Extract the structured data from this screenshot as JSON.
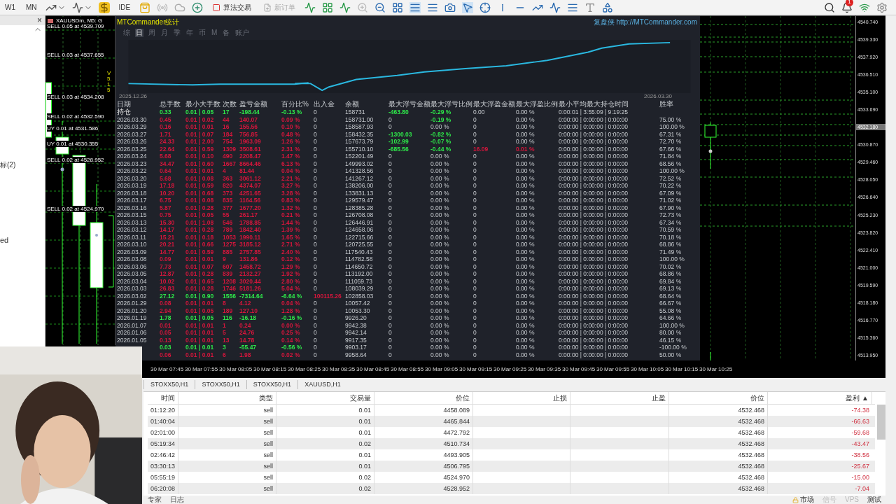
{
  "toolbar": {
    "periods": [
      "W1",
      "MN"
    ],
    "ide": "IDE",
    "algo_trading": {
      "label": "算法交易",
      "on": false
    },
    "new_order": {
      "label": "新订单",
      "disabled": true
    },
    "notifications": "1"
  },
  "navigator": {
    "close": "×",
    "items": [
      "标(2)",
      "ed"
    ]
  },
  "chart": {
    "title": "XAUUSDm, M5: G",
    "version": "V5.15",
    "orders": [
      {
        "text": "SELL 0.05 at 4539.709"
      },
      {
        "text": "SELL 0.03 at 4537.655"
      },
      {
        "text": "SELL 0.03 at 4534.208"
      },
      {
        "text": "SELL 0.02 at 4532.590"
      },
      {
        "text": "UY 0.01 at 4531.586"
      },
      {
        "text": "UY 0.01 at 4530.355"
      },
      {
        "text": "SELL 0.02 at 4528.952"
      },
      {
        "text": "SELL 0.02 at 4524.970"
      }
    ]
  },
  "stats": {
    "title": "MTCommander统计",
    "link": "复盘侠 http://MTCommander.com",
    "tabs": [
      {
        "label": "综",
        "selected": false
      },
      {
        "label": "日",
        "selected": true
      },
      {
        "label": "周",
        "selected": false
      },
      {
        "label": "月",
        "selected": false
      },
      {
        "label": "季",
        "selected": false
      },
      {
        "label": "年",
        "selected": false
      },
      {
        "label": "币",
        "selected": false
      },
      {
        "label": "M",
        "selected": false
      },
      {
        "label": "备",
        "selected": false
      },
      {
        "label": "账户",
        "selected": false
      }
    ],
    "curve": {
      "start": "2025.12.26",
      "end": "2026.03.30"
    },
    "columns": [
      "日期",
      "总手数",
      "最小大手数",
      "次数",
      "盈亏金额",
      "百分比%",
      "出入金",
      "余额",
      "最大浮亏金额",
      "最大浮亏比例",
      "最大浮盈金额",
      "最大浮盈比例",
      "最小平均最大持仓时间",
      "胜率"
    ],
    "rows": [
      {
        "date": "持仓",
        "color": "#2ee84a",
        "lots": "0.33",
        "lot_range": "0.01 | 0.05",
        "count": "17",
        "pnl": "-198.44",
        "pct": "-0.13 %",
        "deposit": "0",
        "balance": "158731",
        "max_loss": {
          "text": "-463.80",
          "color": "#2ee84a"
        },
        "max_loss_pct": {
          "text": "-0.29 %",
          "color": "#2ee84a"
        },
        "max_gain": "0.00",
        "max_gain_pct": "0.00 %",
        "hold_times": "0:00:01 | 3:55:09 | 9:19:25"
      },
      {
        "date": "2026.03.30",
        "color": "#d4163c",
        "lots": "0.45",
        "lot_range": "0.01 | 0.02",
        "count": "44",
        "pnl": "140.07",
        "pct": "0.09 %",
        "deposit": "0",
        "balance": "158731.00",
        "max_loss": "0",
        "max_loss_pct": {
          "text": "-0.19 %",
          "color": "#2ee84a"
        },
        "max_gain": "0",
        "max_gain_pct": "0.00 %",
        "hold_times": "0:00:00 | 0:00:00 | 0:00:00",
        "win_rate": "75.00 %"
      },
      {
        "date": "2026.03.29",
        "color": "#d4163c",
        "lots": "0.16",
        "lot_range": "0.01 | 0.01",
        "count": "16",
        "pnl": "155.56",
        "pct": "0.10 %",
        "deposit": "0",
        "balance": "158587.93",
        "max_loss": "0",
        "max_loss_pct": "0.00 %",
        "max_gain": "0",
        "max_gain_pct": "0.00 %",
        "hold_times": "0:00:00 | 0:00:00 | 0:00:00",
        "win_rate": "100.00 %"
      },
      {
        "date": "2026.03.27",
        "color": "#d4163c",
        "lots": "1.71",
        "lot_range": "0.01 | 0.07",
        "count": "184",
        "pnl": "756.85",
        "pct": "0.48 %",
        "deposit": "0",
        "balance": "158432.35",
        "max_loss": {
          "text": "-1300.03",
          "color": "#2ee84a"
        },
        "max_loss_pct": {
          "text": "-0.82 %",
          "color": "#2ee84a"
        },
        "max_gain": "0",
        "max_gain_pct": "0.00 %",
        "hold_times": "0:00:00 | 0:00:00 | 0:00:00",
        "win_rate": "67.31 %"
      },
      {
        "date": "2026.03.26",
        "color": "#d4163c",
        "lots": "24.33",
        "lot_range": "0.01 | 2.00",
        "count": "754",
        "pnl": "1963.09",
        "pct": "1.26 %",
        "deposit": "0",
        "balance": "157673.79",
        "max_loss": {
          "text": "-102.99",
          "color": "#2ee84a"
        },
        "max_loss_pct": {
          "text": "-0.07 %",
          "color": "#2ee84a"
        },
        "max_gain": "0",
        "max_gain_pct": "0.00 %",
        "hold_times": "0:00:00 | 0:00:00 | 0:00:00",
        "win_rate": "72.70 %"
      },
      {
        "date": "2026.03.25",
        "color": "#d4163c",
        "lots": "22.64",
        "lot_range": "0.01 | 0.59",
        "count": "1309",
        "pnl": "3508.61",
        "pct": "2.31 %",
        "deposit": "0",
        "balance": "155710.10",
        "max_loss": {
          "text": "-685.56",
          "color": "#2ee84a"
        },
        "max_loss_pct": {
          "text": "-0.44 %",
          "color": "#2ee84a"
        },
        "max_gain": {
          "text": "16.09",
          "color": "#d4163c"
        },
        "max_gain_pct": {
          "text": "0.01 %",
          "color": "#d4163c"
        },
        "hold_times": "0:00:00 | 0:00:00 | 0:00:00",
        "win_rate": "67.66 %"
      },
      {
        "date": "2026.03.24",
        "color": "#d4163c",
        "lots": "5.68",
        "lot_range": "0.01 | 0.10",
        "count": "490",
        "pnl": "2208.47",
        "pct": "1.47 %",
        "deposit": "0",
        "balance": "152201.49",
        "max_loss": "0",
        "max_loss_pct": "0.00 %",
        "max_gain": "0",
        "max_gain_pct": "0.00 %",
        "hold_times": "0:00:00 | 0:00:00 | 0:00:00",
        "win_rate": "71.84 %"
      },
      {
        "date": "2026.03.23",
        "color": "#d4163c",
        "lots": "34.47",
        "lot_range": "0.01 | 0.60",
        "count": "1667",
        "pnl": "8664.46",
        "pct": "6.13 %",
        "deposit": "0",
        "balance": "149993.02",
        "max_loss": "0",
        "max_loss_pct": "0.00 %",
        "max_gain": "0",
        "max_gain_pct": "0.00 %",
        "hold_times": "0:00:00 | 0:00:00 | 0:00:00",
        "win_rate": "68.56 %"
      },
      {
        "date": "2026.03.22",
        "color": "#d4163c",
        "lots": "0.64",
        "lot_range": "0.01 | 0.01",
        "count": "4",
        "pnl": "81.44",
        "pct": "0.04 %",
        "deposit": "0",
        "balance": "141328.56",
        "max_loss": "0",
        "max_loss_pct": "0.00 %",
        "max_gain": "0",
        "max_gain_pct": "0.00 %",
        "hold_times": "0:00:00 | 0:00:00 | 0:00:00",
        "win_rate": "100.00 %"
      },
      {
        "date": "2026.03.20",
        "color": "#d4163c",
        "lots": "5.68",
        "lot_range": "0.01 | 0.08",
        "count": "363",
        "pnl": "3061.12",
        "pct": "2.21 %",
        "deposit": "0",
        "balance": "141267.12",
        "max_loss": "0",
        "max_loss_pct": "0.00 %",
        "max_gain": "0",
        "max_gain_pct": "0.00 %",
        "hold_times": "0:00:00 | 0:00:00 | 0:00:00",
        "win_rate": "72.52 %"
      },
      {
        "date": "2026.03.19",
        "color": "#d4163c",
        "lots": "17.18",
        "lot_range": "0.01 | 0.59",
        "count": "820",
        "pnl": "4374.07",
        "pct": "3.27 %",
        "deposit": "0",
        "balance": "138206.00",
        "max_loss": "0",
        "max_loss_pct": "0.00 %",
        "max_gain": "0",
        "max_gain_pct": "0.00 %",
        "hold_times": "0:00:00 | 0:00:00 | 0:00:00",
        "win_rate": "70.22 %"
      },
      {
        "date": "2026.03.18",
        "color": "#d4163c",
        "lots": "10.20",
        "lot_range": "0.01 | 0.68",
        "count": "373",
        "pnl": "4251.65",
        "pct": "3.28 %",
        "deposit": "0",
        "balance": "133831.13",
        "max_loss": "0",
        "max_loss_pct": "0.00 %",
        "max_gain": "0",
        "max_gain_pct": "0.00 %",
        "hold_times": "0:00:00 | 0:00:00 | 0:00:00",
        "win_rate": "67.09 %"
      },
      {
        "date": "2026.03.17",
        "color": "#d4163c",
        "lots": "6.75",
        "lot_range": "0.01 | 0.08",
        "count": "835",
        "pnl": "1164.56",
        "pct": "0.83 %",
        "deposit": "0",
        "balance": "129579.47",
        "max_loss": "0",
        "max_loss_pct": "0.00 %",
        "max_gain": "0",
        "max_gain_pct": "0.00 %",
        "hold_times": "0:00:00 | 0:00:00 | 0:00:00",
        "win_rate": "71.02 %"
      },
      {
        "date": "2026.03.16",
        "color": "#d4163c",
        "lots": "5.87",
        "lot_range": "0.01 | 0.28",
        "count": "377",
        "pnl": "1677.20",
        "pct": "1.32 %",
        "deposit": "0",
        "balance": "128385.28",
        "max_loss": "0",
        "max_loss_pct": "0.00 %",
        "max_gain": "0",
        "max_gain_pct": "0.00 %",
        "hold_times": "0:00:00 | 0:00:00 | 0:00:00",
        "win_rate": "67.90 %"
      },
      {
        "date": "2026.03.15",
        "color": "#d4163c",
        "lots": "0.75",
        "lot_range": "0.01 | 0.05",
        "count": "55",
        "pnl": "261.17",
        "pct": "0.21 %",
        "deposit": "0",
        "balance": "126708.08",
        "max_loss": "0",
        "max_loss_pct": "0.00 %",
        "max_gain": "0",
        "max_gain_pct": "0.00 %",
        "hold_times": "0:00:00 | 0:00:00 | 0:00:00",
        "win_rate": "72.73 %"
      },
      {
        "date": "2026.03.13",
        "color": "#d4163c",
        "lots": "15.30",
        "lot_range": "0.01 | 1.08",
        "count": "546",
        "pnl": "1788.85",
        "pct": "1.44 %",
        "deposit": "0",
        "balance": "126446.91",
        "max_loss": "0",
        "max_loss_pct": "0.00 %",
        "max_gain": "0",
        "max_gain_pct": "0.00 %",
        "hold_times": "0:00:00 | 0:00:00 | 0:00:00",
        "win_rate": "67.34 %"
      },
      {
        "date": "2026.03.12",
        "color": "#d4163c",
        "lots": "14.17",
        "lot_range": "0.01 | 0.28",
        "count": "789",
        "pnl": "1842.40",
        "pct": "1.39 %",
        "deposit": "0",
        "balance": "124658.06",
        "max_loss": "0",
        "max_loss_pct": "0.00 %",
        "max_gain": "0",
        "max_gain_pct": "0.00 %",
        "hold_times": "0:00:00 | 0:00:00 | 0:00:00",
        "win_rate": "70.59 %"
      },
      {
        "date": "2026.03.11",
        "color": "#d4163c",
        "lots": "15.21",
        "lot_range": "0.01 | 0.18",
        "count": "1053",
        "pnl": "1990.11",
        "pct": "1.65 %",
        "deposit": "0",
        "balance": "122715.66",
        "max_loss": "0",
        "max_loss_pct": "0.00 %",
        "max_gain": "0",
        "max_gain_pct": "0.00 %",
        "hold_times": "0:00:00 | 0:00:00 | 0:00:00",
        "win_rate": "70.18 %"
      },
      {
        "date": "2026.03.10",
        "color": "#d4163c",
        "lots": "20.21",
        "lot_range": "0.01 | 0.66",
        "count": "1275",
        "pnl": "3185.12",
        "pct": "2.71 %",
        "deposit": "0",
        "balance": "120725.55",
        "max_loss": "0",
        "max_loss_pct": "0.00 %",
        "max_gain": "0",
        "max_gain_pct": "0.00 %",
        "hold_times": "0:00:00 | 0:00:00 | 0:00:00",
        "win_rate": "68.86 %"
      },
      {
        "date": "2026.03.09",
        "color": "#d4163c",
        "lots": "14.77",
        "lot_range": "0.01 | 0.59",
        "count": "885",
        "pnl": "2757.85",
        "pct": "2.40 %",
        "deposit": "0",
        "balance": "117540.43",
        "max_loss": "0",
        "max_loss_pct": "0.00 %",
        "max_gain": "0",
        "max_gain_pct": "0.00 %",
        "hold_times": "0:00:00 | 0:00:00 | 0:00:00",
        "win_rate": "71.49 %"
      },
      {
        "date": "2026.03.08",
        "color": "#d4163c",
        "lots": "0.09",
        "lot_range": "0.01 | 0.01",
        "count": "9",
        "pnl": "131.86",
        "pct": "0.12 %",
        "deposit": "0",
        "balance": "114782.58",
        "max_loss": "0",
        "max_loss_pct": "0.00 %",
        "max_gain": "0",
        "max_gain_pct": "0.00 %",
        "hold_times": "0:00:00 | 0:00:00 | 0:00:00",
        "win_rate": "100.00 %"
      },
      {
        "date": "2026.03.06",
        "color": "#d4163c",
        "lots": "7.73",
        "lot_range": "0.01 | 0.07",
        "count": "607",
        "pnl": "1458.72",
        "pct": "1.29 %",
        "deposit": "0",
        "balance": "114650.72",
        "max_loss": "0",
        "max_loss_pct": "0.00 %",
        "max_gain": "0",
        "max_gain_pct": "0.00 %",
        "hold_times": "0:00:00 | 0:00:00 | 0:00:00",
        "win_rate": "70.02 %"
      },
      {
        "date": "2026.03.05",
        "color": "#d4163c",
        "lots": "12.87",
        "lot_range": "0.01 | 0.28",
        "count": "839",
        "pnl": "2132.27",
        "pct": "1.92 %",
        "deposit": "0",
        "balance": "113192.00",
        "max_loss": "0",
        "max_loss_pct": "0.00 %",
        "max_gain": "0",
        "max_gain_pct": "0.00 %",
        "hold_times": "0:00:00 | 0:00:00 | 0:00:00",
        "win_rate": "68.86 %"
      },
      {
        "date": "2026.03.04",
        "color": "#d4163c",
        "lots": "10.02",
        "lot_range": "0.01 | 0.65",
        "count": "1208",
        "pnl": "3020.44",
        "pct": "2.80 %",
        "deposit": "0",
        "balance": "111059.73",
        "max_loss": "0",
        "max_loss_pct": "0.00 %",
        "max_gain": "0",
        "max_gain_pct": "0.00 %",
        "hold_times": "0:00:00 | 0:00:00 | 0:00:00",
        "win_rate": "69.84 %"
      },
      {
        "date": "2026.03.03",
        "color": "#d4163c",
        "lots": "26.83",
        "lot_range": "0.01 | 0.28",
        "count": "1746",
        "pnl": "5181.26",
        "pct": "5.04 %",
        "deposit": "0",
        "balance": "108039.29",
        "max_loss": "0",
        "max_loss_pct": "0.00 %",
        "max_gain": "0",
        "max_gain_pct": "0.00 %",
        "hold_times": "0:00:00 | 0:00:00 | 0:00:00",
        "win_rate": "69.13 %"
      },
      {
        "date": "2026.03.02",
        "color": "#2ee84a",
        "lots": "27.12",
        "lot_range": "0.01 | 0.90",
        "count": "1556",
        "pnl": "-7314.64",
        "pct": "-6.64 %",
        "deposit": {
          "text": "100115.26",
          "color": "#d4163c"
        },
        "balance": "102858.03",
        "max_loss": "0",
        "max_loss_pct": "0.00 %",
        "max_gain": "0",
        "max_gain_pct": "0.00 %",
        "hold_times": "0:00:00 | 0:00:00 | 0:00:00",
        "win_rate": "68.64 %"
      },
      {
        "date": "2026.01.29",
        "color": "#d4163c",
        "lots": "0.08",
        "lot_range": "0.01 | 0.01",
        "count": "8",
        "pnl": "4.12",
        "pct": "0.04 %",
        "deposit": "0",
        "balance": "10057.42",
        "max_loss": "0",
        "max_loss_pct": "0.00 %",
        "max_gain": "0",
        "max_gain_pct": "0.00 %",
        "hold_times": "0:00:00 | 0:00:00 | 0:00:00",
        "win_rate": "66.67 %"
      },
      {
        "date": "2026.01.20",
        "color": "#d4163c",
        "lots": "2.94",
        "lot_range": "0.01 | 0.05",
        "count": "189",
        "pnl": "127.10",
        "pct": "1.28 %",
        "deposit": "0",
        "balance": "10053.30",
        "max_loss": "0",
        "max_loss_pct": "0.00 %",
        "max_gain": "0",
        "max_gain_pct": "0.00 %",
        "hold_times": "0:00:00 | 0:00:00 | 0:00:00",
        "win_rate": "55.08 %"
      },
      {
        "date": "2026.01.19",
        "color": "#2ee84a",
        "lots": "1.78",
        "lot_range": "0.01 | 0.05",
        "count": "116",
        "pnl": "-16.18",
        "pct": "-0.16 %",
        "deposit": "0",
        "balance": "9926.20",
        "max_loss": "0",
        "max_loss_pct": "0.00 %",
        "max_gain": "0",
        "max_gain_pct": "0.00 %",
        "hold_times": "0:00:00 | 0:00:00 | 0:00:00",
        "win_rate": "64.66 %"
      },
      {
        "date": "2026.01.07",
        "color": "#d4163c",
        "lots": "0.01",
        "lot_range": "0.01 | 0.01",
        "count": "1",
        "pnl": "0.24",
        "pct": "0.00 %",
        "deposit": "0",
        "balance": "9942.38",
        "max_loss": "0",
        "max_loss_pct": "0.00 %",
        "max_gain": "0",
        "max_gain_pct": "0.00 %",
        "hold_times": "0:00:00 | 0:00:00 | 0:00:00",
        "win_rate": "100.00 %"
      },
      {
        "date": "2026.01.06",
        "color": "#d4163c",
        "lots": "0.05",
        "lot_range": "0.01 | 0.01",
        "count": "5",
        "pnl": "24.76",
        "pct": "0.25 %",
        "deposit": "0",
        "balance": "9942.14",
        "max_loss": "0",
        "max_loss_pct": "0.00 %",
        "max_gain": "0",
        "max_gain_pct": "0.00 %",
        "hold_times": "0:00:00 | 0:00:00 | 0:00:00",
        "win_rate": "80.00 %"
      },
      {
        "date": "2026.01.05",
        "color": "#d4163c",
        "lots": "0.13",
        "lot_range": "0.01 | 0.01",
        "count": "13",
        "pnl": "14.78",
        "pct": "0.14 %",
        "deposit": "0",
        "balance": "9917.35",
        "max_loss": "0",
        "max_loss_pct": "0.00 %",
        "max_gain": "0",
        "max_gain_pct": "0.00 %",
        "hold_times": "0:00:00 | 0:00:00 | 0:00:00",
        "win_rate": "46.15 %"
      },
      {
        "color": "#2ee84a",
        "lots": "0.03",
        "lot_range": "0.01 | 0.01",
        "count": "3",
        "pnl": "-55.47",
        "pct": "-0.56 %",
        "deposit": "0",
        "balance": "9903.17",
        "max_loss": "0",
        "max_loss_pct": "0.00 %",
        "max_gain": "0",
        "max_gain_pct": "0.00 %",
        "hold_times": "0:00:00 | 0:00:00 | 0:00:00",
        "win_rate": "-100.00 %"
      },
      {
        "color": "#d4163c",
        "lots": "0.06",
        "lot_range": "0.01 | 0.01",
        "count": "6",
        "pnl": "1.98",
        "pct": "0.02 %",
        "deposit": "0",
        "balance": "9958.64",
        "max_loss": "0",
        "max_loss_pct": "0.00 %",
        "max_gain": "0",
        "max_gain_pct": "0.00 %",
        "hold_times": "0:00:00 | 0:00:00 | 0:00:00",
        "win_rate": "50.00 %"
      }
    ]
  },
  "price_axis": [
    {
      "label": "4540.740",
      "current": false
    },
    {
      "label": "4539.330",
      "current": false
    },
    {
      "label": "4537.920",
      "current": false
    },
    {
      "label": "4536.510",
      "current": false
    },
    {
      "label": "4535.100",
      "current": false
    },
    {
      "label": "4533.690",
      "current": false
    },
    {
      "label": "4532.180",
      "current": true
    },
    {
      "label": "4530.870",
      "current": false
    },
    {
      "label": "4529.460",
      "current": false
    },
    {
      "label": "4528.050",
      "current": false
    },
    {
      "label": "4526.640",
      "current": false
    },
    {
      "label": "4525.230",
      "current": false
    },
    {
      "label": "4523.820",
      "current": false
    },
    {
      "label": "4522.410",
      "current": false
    },
    {
      "label": "4521.000",
      "current": false
    },
    {
      "label": "4519.590",
      "current": false
    },
    {
      "label": "4518.180",
      "current": false
    },
    {
      "label": "4516.770",
      "current": false
    },
    {
      "label": "4515.360",
      "current": false
    },
    {
      "label": "4513.950",
      "current": false
    }
  ],
  "time_axis": [
    "30 Mar 07:45",
    "30 Mar 07:55",
    "30 Mar 08:05",
    "30 Mar 08:15",
    "30 Mar 08:25",
    "30 Mar 08:35",
    "30 Mar 08:45",
    "30 Mar 08:55",
    "30 Mar 09:05",
    "30 Mar 09:15",
    "30 Mar 09:25",
    "30 Mar 09:35",
    "30 Mar 09:45",
    "30 Mar 09:55",
    "30 Mar 10:05",
    "30 Mar 10:15",
    "30 Mar 10:25"
  ],
  "chart_tabs": [
    {
      "label": "STOXX50,H1",
      "selected": false
    },
    {
      "label": "STOXX50,H1",
      "selected": false
    },
    {
      "label": "STOXX50,H1",
      "selected": false
    },
    {
      "label": "XAUUSD,H1",
      "selected": false
    }
  ],
  "trades": {
    "columns": [
      {
        "label": "时间"
      },
      {
        "label": "类型"
      },
      {
        "label": "交易量"
      },
      {
        "label": "价位"
      },
      {
        "label": "止损"
      },
      {
        "label": "止盈"
      },
      {
        "label": "价位"
      },
      {
        "label": "盈利",
        "sort": "▲"
      }
    ],
    "rows": [
      {
        "time": "01:12:20",
        "type": "sell",
        "volume": "0.01",
        "open_price": "4458.089",
        "price": "4532.468",
        "profit": "-74.38"
      },
      {
        "time": "01:40:04",
        "type": "sell",
        "volume": "0.01",
        "open_price": "4465.844",
        "price": "4532.468",
        "profit": "-66.63"
      },
      {
        "time": "02:01:00",
        "type": "sell",
        "volume": "0.01",
        "open_price": "4472.792",
        "price": "4532.468",
        "profit": "-59.68"
      },
      {
        "time": "05:19:34",
        "type": "sell",
        "volume": "0.02",
        "open_price": "4510.734",
        "price": "4532.468",
        "profit": "-43.47"
      },
      {
        "time": "02:46:42",
        "type": "sell",
        "volume": "0.01",
        "open_price": "4493.905",
        "price": "4532.468",
        "profit": "-38.56"
      },
      {
        "time": "03:30:13",
        "type": "sell",
        "volume": "0.01",
        "open_price": "4506.795",
        "price": "4532.468",
        "profit": "-25.67"
      },
      {
        "time": "05:55:19",
        "type": "sell",
        "volume": "0.02",
        "open_price": "4524.970",
        "price": "4532.468",
        "profit": "-15.00"
      },
      {
        "time": "06:20:08",
        "type": "sell",
        "volume": "0.02",
        "open_price": "4528.952",
        "price": "4532.468",
        "profit": "-7.04"
      }
    ]
  },
  "status_bar": {
    "tabs": [
      "专家",
      "日志"
    ],
    "items": [
      {
        "label": "市场",
        "disabled": false
      },
      {
        "label": "信号",
        "disabled": true
      },
      {
        "label": "VPS",
        "disabled": true
      },
      {
        "label": "测试",
        "disabled": false
      }
    ]
  }
}
